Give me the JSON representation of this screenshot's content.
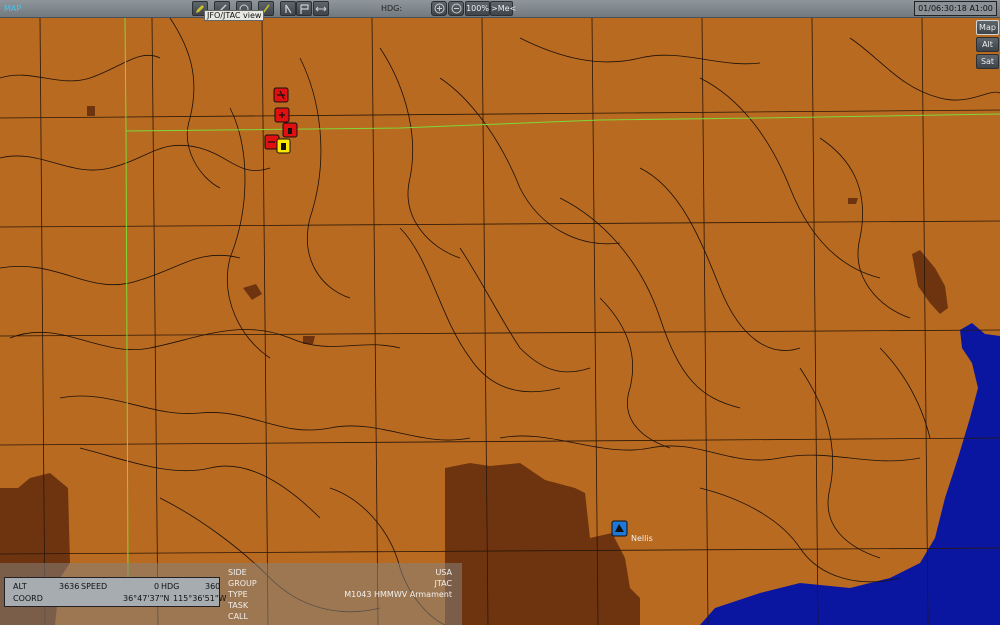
{
  "topbar": {
    "map_label": "MAP",
    "hdg_label": "HDG:",
    "zoom_label": "100%",
    "me_label": ">Me<",
    "clock": "01/06:30:18 A1:00",
    "tooltip": "JFO/JTAC view",
    "tool_icons": [
      "pencil-icon",
      "line-icon",
      "ruler-icon",
      "measure-icon",
      "waypoint-icon",
      "flag-icon",
      "arrows-icon"
    ]
  },
  "view_buttons": [
    "Map",
    "Alt",
    "Sat"
  ],
  "map": {
    "airfield_label": "Nellis",
    "colors": {
      "terrain": "#b86a20",
      "lowland": "#6e3410",
      "water": "#0a16a0",
      "border": "#7ed83a",
      "red_unit": "#e01010",
      "blue_unit": "#1e78d8",
      "selected": "#ffe800"
    }
  },
  "info": {
    "alt_label": "ALT",
    "alt_value": "3636",
    "speed_label": "SPEED",
    "speed_value": "0",
    "hdg_label": "HDG",
    "hdg_value": "360",
    "coord_label": "COORD",
    "lat": "36°47'37\"N",
    "lon": "115°36'51\"W"
  },
  "unit": {
    "side_label": "SIDE",
    "side_value": "USA",
    "group_label": "GROUP",
    "group_value": "JTAC",
    "type_label": "TYPE",
    "type_value": "M1043 HMMWV Armament",
    "task_label": "TASK",
    "task_value": "",
    "call_label": "CALL",
    "call_value": ""
  }
}
